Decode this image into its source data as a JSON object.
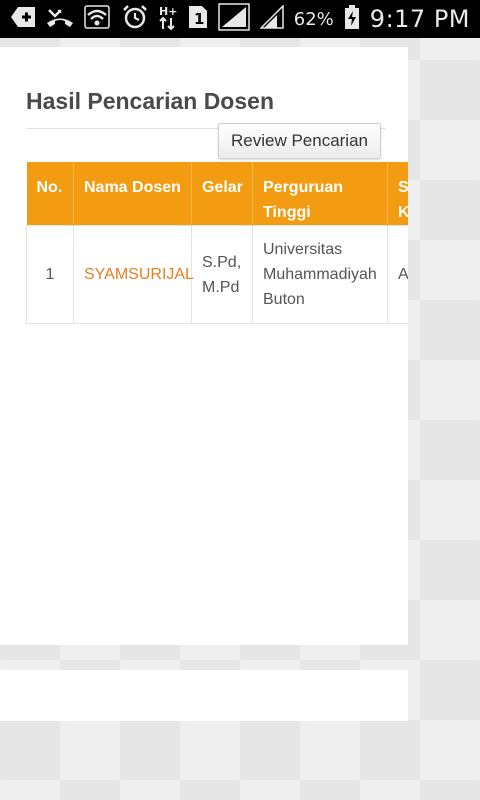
{
  "status_bar": {
    "battery_percent": "62%",
    "time": "9:17 PM",
    "sim_slot": "1",
    "network_type": "H+",
    "icons": [
      "add-icon",
      "missed-call-icon",
      "wifi-icon",
      "alarm-icon",
      "data-arrows-icon",
      "sim-icon",
      "signal-icon",
      "signal-icon-2",
      "battery-charging-icon"
    ]
  },
  "page": {
    "title": "Hasil Pencarian Dosen",
    "review_button": "Review Pencarian"
  },
  "table": {
    "headers": [
      "No.",
      "Nama Dosen",
      "Gelar",
      "Perguruan Tinggi",
      "Status Keaktifan"
    ],
    "rows": [
      {
        "no": "1",
        "nama": "SYAMSURIJAL",
        "gelar": "S.Pd, M.Pd",
        "pt": "Universitas Muhammadiyah Buton",
        "status": "Aktif"
      }
    ]
  },
  "colors": {
    "accent": "#f39c12",
    "link": "#e67e22"
  }
}
